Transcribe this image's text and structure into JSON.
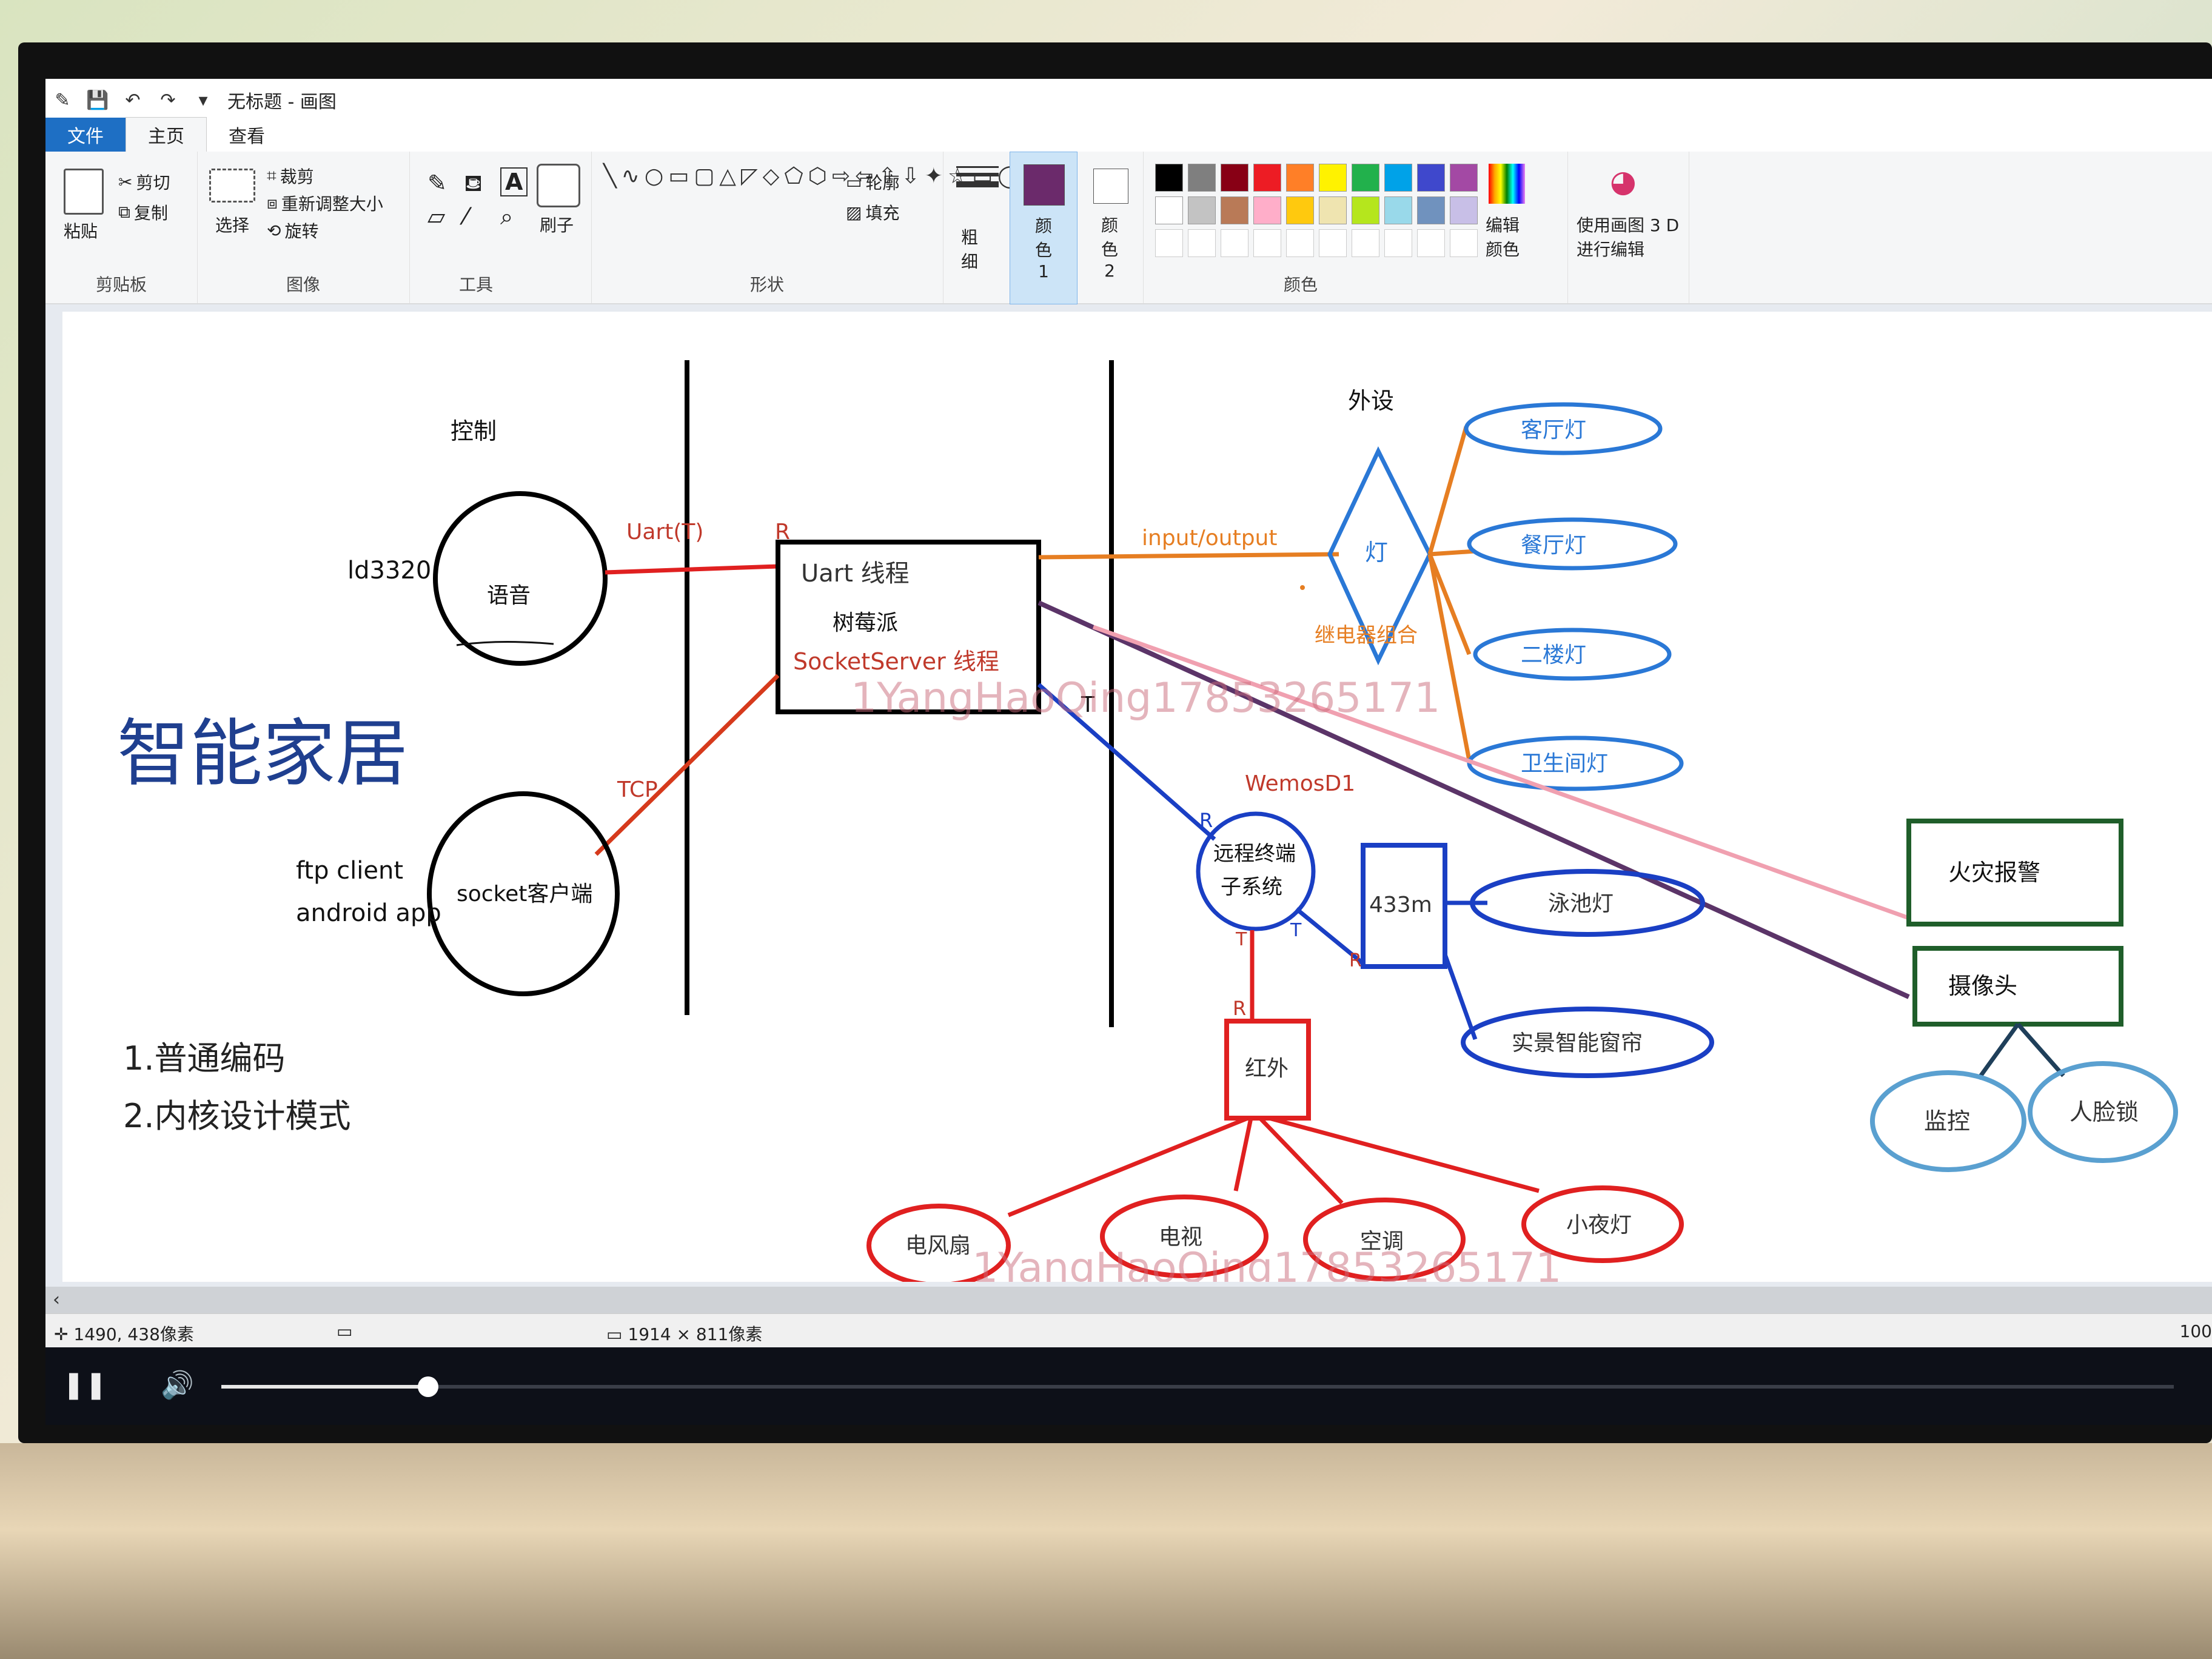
{
  "window": {
    "title": "无标题 - 画图"
  },
  "tabs": {
    "file": "文件",
    "home": "主页",
    "view": "查看"
  },
  "ribbon": {
    "clipboard": {
      "paste": "粘贴",
      "cut": "剪切",
      "copy": "复制",
      "label": "剪贴板"
    },
    "image": {
      "select": "选择",
      "crop": "裁剪",
      "resize": "重新调整大小",
      "rotate": "旋转",
      "label": "图像"
    },
    "tools": {
      "label": "工具",
      "brush": "刷子"
    },
    "shapes": {
      "outline": "轮廓",
      "fill": "填充",
      "label": "形状"
    },
    "size": "粗细",
    "color1": "颜色 1",
    "color2": "颜色 2",
    "edit_colors": "编辑颜色",
    "paint3d": "使用画图 3 D 进行编辑",
    "colors_label": "颜色",
    "palette": [
      "#000000",
      "#7f7f7f",
      "#880015",
      "#ed1c24",
      "#ff7f27",
      "#fff200",
      "#22b14c",
      "#00a2e8",
      "#3f48cc",
      "#a349a4",
      "#ffffff",
      "#c3c3c3",
      "#b97a57",
      "#ffaec9",
      "#ffc90e",
      "#efe4b0",
      "#b5e61d",
      "#99d9ea",
      "#7092be",
      "#c8bfe7"
    ],
    "color1_value": "#6b2a6b"
  },
  "diagram": {
    "control": "控制",
    "peripheral": "外设",
    "ld3320": "ld3320",
    "voice": "语音",
    "uart_t": "Uart(T)",
    "r1": "R",
    "uart_thread": "Uart 线程",
    "raspberry": "树莓派",
    "socket_server": "SocketServer 线程",
    "title": "智能家居",
    "tcp": "TCP",
    "ftp_client": "ftp client",
    "android_app": "android app",
    "socket_client": "socket客户端",
    "input_output": "input/output",
    "lamp": "灯",
    "relay_group": "继电器组合",
    "living_light": "客厅灯",
    "dining_light": "餐厅灯",
    "second_floor_light": "二楼灯",
    "bathroom_light": "卫生间灯",
    "t1": "T",
    "wemos": "WemosD1",
    "r2": "R",
    "remote_terminal_1": "远程终端",
    "remote_terminal_2": "子系统",
    "t2": "T",
    "t3": "T",
    "module433": "433m",
    "r3": "R",
    "pool_light": "泳池灯",
    "smart_curtain": "实景智能窗帘",
    "r4": "R",
    "infrared": "红外",
    "fire_alarm": "火灾报警",
    "camera": "摄像头",
    "monitor": "监控",
    "face_lock": "人脸锁",
    "fan": "电风扇",
    "tv": "电视",
    "ac": "空调",
    "night_light": "小夜灯",
    "list_1": "1.普通编码",
    "list_2": "2.内核设计模式",
    "watermark": "1YangHaoQing17853265171"
  },
  "status": {
    "cursor": "1490, 438像素",
    "canvas_size": "1914 × 811像素",
    "zoom": "100"
  },
  "player": {
    "progress_percent": 10.6
  }
}
